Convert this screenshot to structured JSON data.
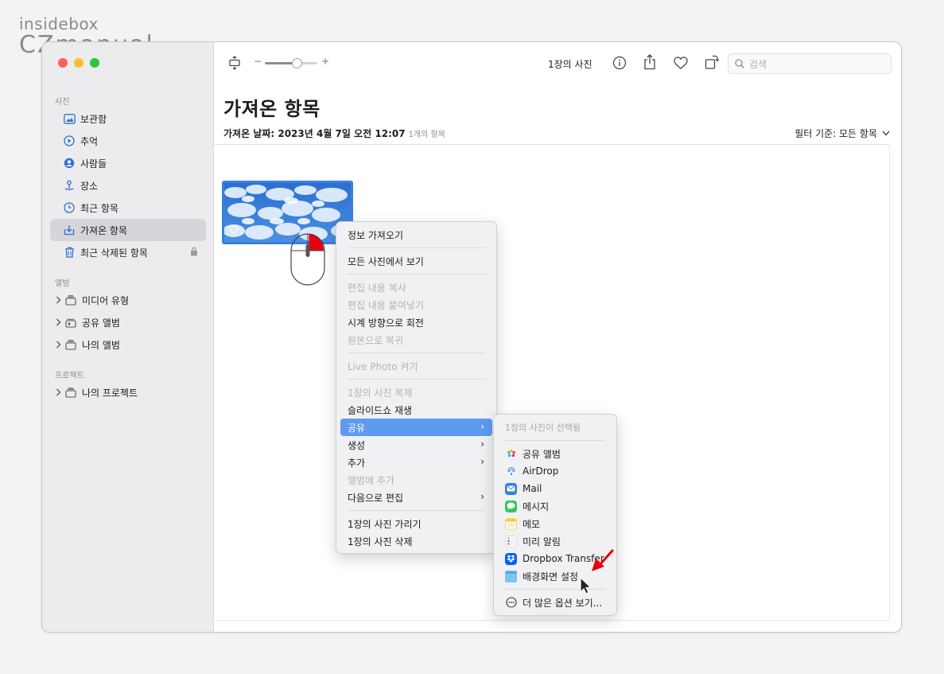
{
  "watermark": {
    "top": "insidebox",
    "bottom": "CZmanual"
  },
  "sidebar": {
    "section_photos": "사진",
    "items": [
      {
        "label": "보관함",
        "icon": "library-icon"
      },
      {
        "label": "추억",
        "icon": "memories-icon"
      },
      {
        "label": "사람들",
        "icon": "people-icon"
      },
      {
        "label": "장소",
        "icon": "places-icon"
      },
      {
        "label": "최근 항목",
        "icon": "recents-icon"
      },
      {
        "label": "가져온 항목",
        "icon": "imports-icon"
      },
      {
        "label": "최근 삭제된 항목",
        "icon": "trash-icon"
      }
    ],
    "section_albums": "앨범",
    "albums": [
      {
        "label": "미디어 유형"
      },
      {
        "label": "공유 앨범"
      },
      {
        "label": "나의 앨범"
      }
    ],
    "section_projects": "프로젝트",
    "projects": [
      {
        "label": "나의 프로젝트"
      }
    ]
  },
  "toolbar": {
    "zoom_minus": "−",
    "zoom_plus": "+",
    "zoom_level": 0.6,
    "photo_count": "1장의 사진",
    "search_placeholder": "검색"
  },
  "main": {
    "title": "가져온 항목",
    "import_date": "가져온 날짜: 2023년 4월 7일 오전 12:07",
    "item_count": "1개의 항목",
    "filter": "필터 기준: 모든 항목"
  },
  "context_menu": {
    "items": [
      {
        "label": "정보 가져오기",
        "disabled": false
      },
      {
        "label": "모든 사진에서 보기",
        "disabled": false
      },
      {
        "label": "편집 내용 복사",
        "disabled": true
      },
      {
        "label": "편집 내용 붙여넣기",
        "disabled": true
      },
      {
        "label": "시계 방향으로 회전",
        "disabled": false
      },
      {
        "label": "원본으로 복귀",
        "disabled": true
      },
      {
        "label": "Live Photo 켜기",
        "disabled": true
      },
      {
        "label": "1장의 사진 복제",
        "disabled": true
      },
      {
        "label": "슬라이드쇼 재생",
        "disabled": false
      },
      {
        "label": "공유",
        "disabled": false,
        "submenu": true,
        "active": true
      },
      {
        "label": "생성",
        "disabled": false,
        "submenu": true
      },
      {
        "label": "추가",
        "disabled": false,
        "submenu": true
      },
      {
        "label": "앨범에 추가",
        "disabled": true
      },
      {
        "label": "다음으로 편집",
        "disabled": false,
        "submenu": true
      },
      {
        "label": "1장의 사진 가리기",
        "disabled": false
      },
      {
        "label": "1장의 사진 삭제",
        "disabled": false
      }
    ]
  },
  "share_submenu": {
    "header": "1장의 사진이 선택됨",
    "items": [
      {
        "label": "공유 앨범",
        "icon": "shared-album-icon",
        "color": "#f2994a"
      },
      {
        "label": "AirDrop",
        "icon": "airdrop-icon",
        "color": "#3b82f6"
      },
      {
        "label": "Mail",
        "icon": "mail-icon",
        "color": "#2f7fe8"
      },
      {
        "label": "메시지",
        "icon": "messages-icon",
        "color": "#34c759"
      },
      {
        "label": "메모",
        "icon": "notes-icon",
        "color": "#f5d547"
      },
      {
        "label": "미리 알림",
        "icon": "reminders-icon",
        "color": "#ffffff"
      },
      {
        "label": "Dropbox Transfer",
        "icon": "dropbox-icon",
        "color": "#0061fe"
      },
      {
        "label": "배경화면 설정",
        "icon": "wallpaper-icon",
        "color": "#7cc4f0"
      }
    ],
    "more": "더 많은 옵션 보기..."
  },
  "colors": {
    "accent": "#5e9bf0",
    "annotation": "#e60012"
  }
}
